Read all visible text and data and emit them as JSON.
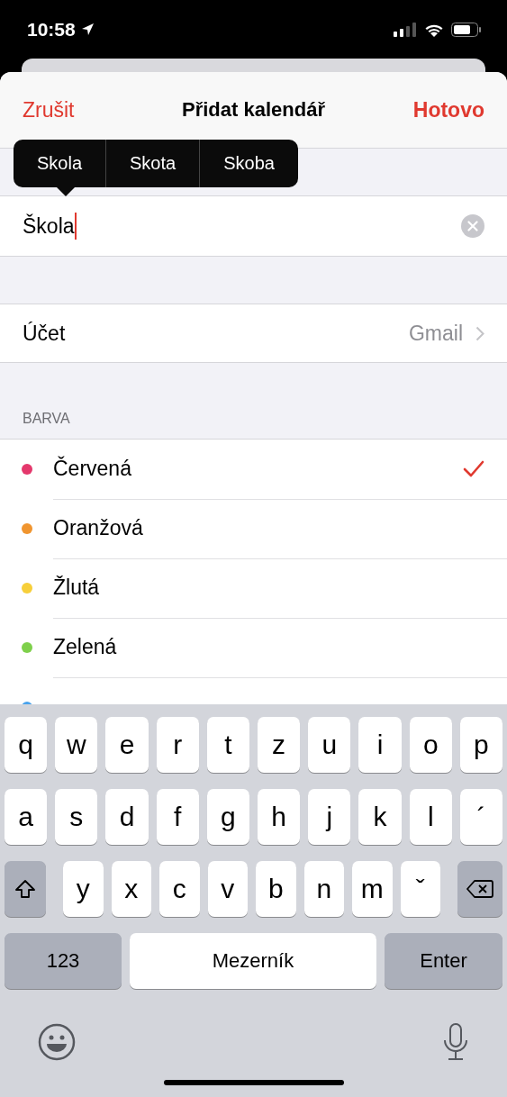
{
  "status_bar": {
    "time": "10:58"
  },
  "nav": {
    "cancel": "Zrušit",
    "title": "Přidat kalendář",
    "done": "Hotovo"
  },
  "suggestions": [
    "Skola",
    "Skota",
    "Skoba"
  ],
  "name_field": {
    "value": "Škola"
  },
  "account": {
    "label": "Účet",
    "value": "Gmail"
  },
  "color_section": {
    "header": "BARVA",
    "items": [
      {
        "name": "Červená",
        "color": "#e4386c",
        "selected": true
      },
      {
        "name": "Oranžová",
        "color": "#f0952f",
        "selected": false
      },
      {
        "name": "Žlutá",
        "color": "#f7cf3a",
        "selected": false
      },
      {
        "name": "Zelená",
        "color": "#7ed04b",
        "selected": false
      },
      {
        "color": "#4aa3ec",
        "selected": false
      }
    ]
  },
  "keyboard": {
    "letters_row_1": [
      "q",
      "w",
      "e",
      "r",
      "t",
      "z",
      "u",
      "i",
      "o",
      "p"
    ],
    "letters_row_2": [
      "a",
      "s",
      "d",
      "f",
      "g",
      "h",
      "j",
      "k",
      "l",
      "´"
    ],
    "letters_row_3": [
      "y",
      "x",
      "c",
      "v",
      "b",
      "n",
      "m",
      "ˇ"
    ],
    "numbers_key": "123",
    "space_key": "Mezerník",
    "enter_key": "Enter"
  }
}
